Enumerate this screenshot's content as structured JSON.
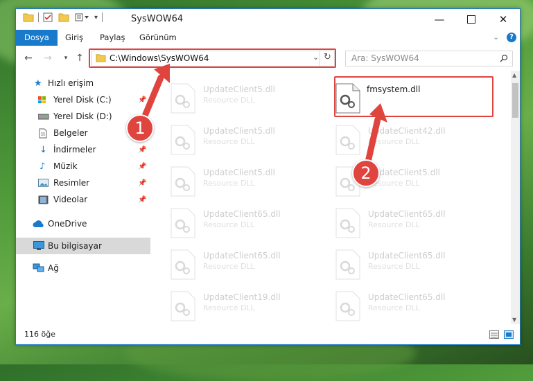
{
  "window": {
    "title": "SysWOW64"
  },
  "ribbon": {
    "tabs": [
      "Dosya",
      "Giriş",
      "Paylaş",
      "Görünüm"
    ]
  },
  "navbar": {
    "address": "C:\\Windows\\SysWOW64",
    "search_placeholder": "Ara: SysWOW64"
  },
  "sidebar": {
    "quick_access": "Hızlı erişim",
    "items": [
      "Yerel Disk (C:)",
      "Yerel Disk (D:)",
      "Belgeler",
      "İndirmeler",
      "Müzik",
      "Resimler",
      "Videolar"
    ],
    "onedrive": "OneDrive",
    "this_pc": "Bu bilgisayar",
    "network": "Ağ"
  },
  "files": {
    "highlighted": {
      "name": "fmsystem.dll",
      "type": ""
    },
    "left_column": [
      {
        "name": "UpdateClient5.dll",
        "type": "Resource DLL"
      },
      {
        "name": "UpdateClient5.dll",
        "type": "Resource DLL"
      },
      {
        "name": "UpdateClient5.dll",
        "type": "Resource DLL"
      },
      {
        "name": "UpdateClient65.dll",
        "type": "Resource DLL"
      },
      {
        "name": "UpdateClient65.dll",
        "type": "Resource DLL"
      },
      {
        "name": "UpdateClient19.dll",
        "type": "Resource DLL"
      }
    ],
    "right_column": [
      {
        "name": "UpdateClient42.dll",
        "type": "Resource DLL"
      },
      {
        "name": "UpdateClient5.dll",
        "type": "Resource DLL"
      },
      {
        "name": "UpdateClient65.dll",
        "type": "Resource DLL"
      },
      {
        "name": "UpdateClient65.dll",
        "type": "Resource DLL"
      },
      {
        "name": "UpdateClient65.dll",
        "type": "Resource DLL"
      }
    ]
  },
  "status": {
    "count": "116 öğe"
  },
  "callouts": [
    "1",
    "2"
  ],
  "colors": {
    "accent": "#1979ca",
    "highlight": "#e0443e",
    "selection": "#d9d9d9"
  }
}
